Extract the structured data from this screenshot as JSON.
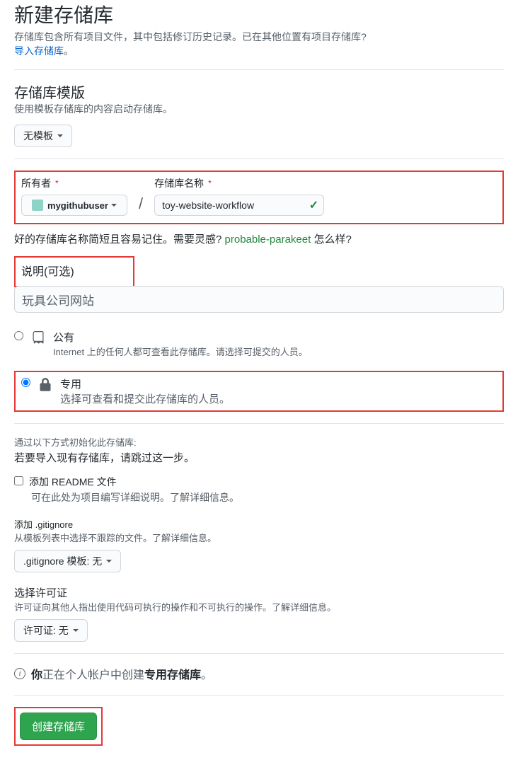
{
  "header": {
    "title": "新建存储库",
    "subtitle_prefix": "存储库包含所有项目文件，其中包括修订历史记录。已在其他位置有项目存储库?",
    "import_link": "导入存储库",
    "period": "。"
  },
  "template": {
    "title": "存储库模版",
    "desc": "使用模板存储库的内容启动存储库。",
    "button": "无模板"
  },
  "owner": {
    "label": "所有者",
    "name": "mygithubuser"
  },
  "repo": {
    "label": "存储库名称",
    "value": "toy-website-workflow"
  },
  "hint": {
    "prefix": "好的存储库名称简短且容易记住。需要灵感? ",
    "suggestion": "probable-parakeet",
    "suffix": " 怎么样?"
  },
  "description": {
    "label": "说明(可选)",
    "value": "玩具公司网站"
  },
  "visibility": {
    "public": {
      "title": "公有",
      "desc": "Internet 上的任何人都可查看此存储库。请选择可提交的人员。"
    },
    "private": {
      "title": "专用",
      "desc": "选择可查看和提交此存储库的人员。"
    }
  },
  "init": {
    "heading": "通过以下方式初始化此存储库:",
    "skip": "若要导入现有存储库，请跳过这一步。",
    "readme": {
      "label": "添加 README 文件",
      "desc": "可在此处为项目编写详细说明。了解详细信息。"
    },
    "gitignore": {
      "label": "添加 .gitignore",
      "desc": "从模板列表中选择不跟踪的文件。了解详细信息。",
      "button": ".gitignore 模板: 无"
    },
    "license": {
      "label": "选择许可证",
      "desc": "许可证向其他人指出使用代码可执行的操作和不可执行的操作。了解详细信息。",
      "button": "许可证: 无"
    }
  },
  "info": {
    "p1": "你",
    "p2": "正在个人帐户中创建",
    "p3": "专用存储库",
    "p4": "。"
  },
  "create": {
    "button": "创建存储库"
  }
}
